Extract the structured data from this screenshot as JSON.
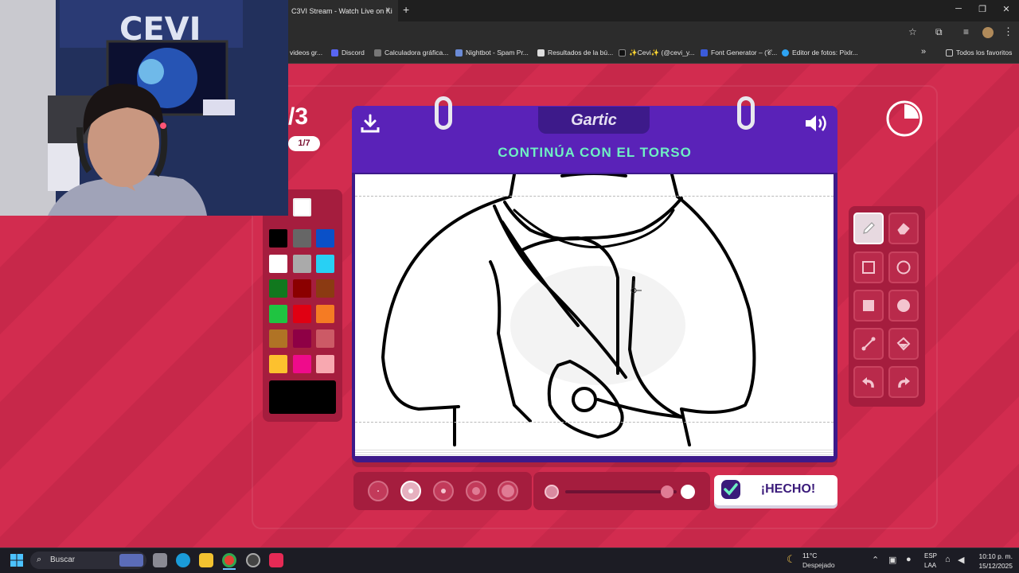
{
  "browser": {
    "tab_title": "C3VI Stream - Watch Live on Ki",
    "tab_close": "×",
    "new_tab": "+",
    "window_controls": {
      "minimize": "─",
      "restore": "❐",
      "close": "✕"
    },
    "bookmarks": [
      {
        "label": "videos gr...",
        "icon_color": "#888888"
      },
      {
        "label": "Discord",
        "icon_color": "#5865f2"
      },
      {
        "label": "Calculadora gráfica...",
        "icon_color": "#777777"
      },
      {
        "label": "Nightbot - Spam Pr...",
        "icon_color": "#6b8bd6"
      },
      {
        "label": "Resultados de la bú...",
        "icon_color": "#dddddd"
      },
      {
        "label": "✨Cevi✨ (@cevi_y...",
        "icon_color": "#111111"
      },
      {
        "label": "Font Generator – (𝒞...",
        "icon_color": "#3b5bdb"
      },
      {
        "label": "Editor de fotos: Pixlr...",
        "icon_color": "#2ea3f2"
      }
    ],
    "bookmarks_more": "»",
    "all_bookmarks": "Todos los favoritos"
  },
  "game": {
    "round_counter": "/3",
    "round_pill": "1/7",
    "logo": "Gartic",
    "instruction": "CONTINÚA CON EL TORSO",
    "done_label": "¡HECHO!",
    "timer_remaining_fraction": 0.75,
    "palette_colors": [
      "#000000",
      "#666666",
      "#0a50c8",
      "#ffffff",
      "#aaaaaa",
      "#28d0f4",
      "#11781e",
      "#8b0000",
      "#8b3a12",
      "#1fc441",
      "#e00012",
      "#f57b23",
      "#b07325",
      "#8e0045",
      "#cc5a66",
      "#fdc12e",
      "#ef0b8b",
      "#f8a8b0"
    ],
    "extra_color": "#ffffff",
    "selected_color": "#000000",
    "tools": [
      {
        "name": "pencil",
        "active": true
      },
      {
        "name": "eraser",
        "active": false
      },
      {
        "name": "rectangle-outline",
        "active": false
      },
      {
        "name": "circle-outline",
        "active": false
      },
      {
        "name": "rectangle-filled",
        "active": false
      },
      {
        "name": "circle-filled",
        "active": false
      },
      {
        "name": "line",
        "active": false
      },
      {
        "name": "fill-bucket",
        "active": false
      },
      {
        "name": "undo",
        "active": false
      },
      {
        "name": "redo",
        "active": false
      }
    ],
    "brush_sizes_selected": 2,
    "brush_sizes_count": 5
  },
  "taskbar": {
    "search_label": "Buscar",
    "weather_temp": "11°C",
    "weather_desc": "Despejado",
    "lang_top": "ESP",
    "lang_bottom": "LAA",
    "time": "10:10 p. m.",
    "date": "15/12/2025"
  }
}
